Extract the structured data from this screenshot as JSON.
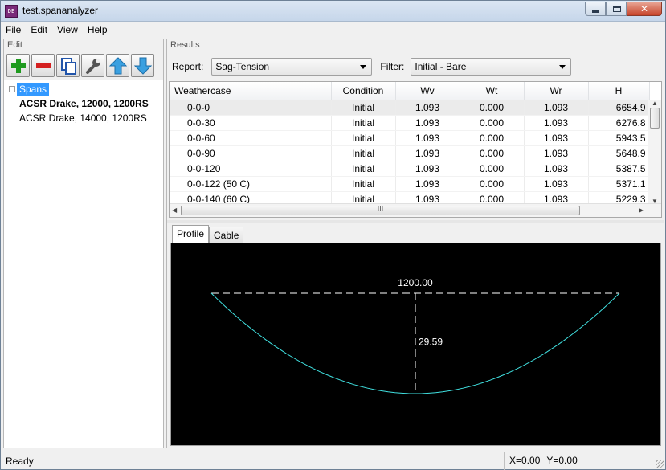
{
  "window": {
    "title": "test.spananalyzer",
    "icon": "app-icon",
    "icon_text": "DE"
  },
  "menu": [
    "File",
    "Edit",
    "View",
    "Help"
  ],
  "edit_pane": {
    "caption": "Edit",
    "toolbar": [
      {
        "name": "add-button",
        "icon": "plus-icon",
        "color": "#1f9a1f"
      },
      {
        "name": "delete-button",
        "icon": "minus-icon",
        "color": "#d42020"
      },
      {
        "name": "copy-button",
        "icon": "copy-icon",
        "color": "#2255aa"
      },
      {
        "name": "edit-button",
        "icon": "wrench-icon",
        "color": "#555555"
      },
      {
        "name": "move-up-button",
        "icon": "arrow-up-icon",
        "color": "#3aa0e0"
      },
      {
        "name": "move-down-button",
        "icon": "arrow-down-icon",
        "color": "#3aa0e0"
      }
    ],
    "tree": {
      "root": "Spans",
      "items": [
        {
          "label": "ACSR Drake, 12000, 1200RS",
          "bold": true
        },
        {
          "label": "ACSR Drake, 14000, 1200RS",
          "bold": false
        }
      ]
    }
  },
  "results_pane": {
    "caption": "Results",
    "report_label": "Report:",
    "report_value": "Sag-Tension",
    "filter_label": "Filter:",
    "filter_value": "Initial - Bare",
    "table": {
      "columns": [
        "Weathercase",
        "Condition",
        "Wv",
        "Wt",
        "Wr",
        "H"
      ],
      "rows": [
        [
          "0-0-0",
          "Initial",
          "1.093",
          "0.000",
          "1.093",
          "6654.9"
        ],
        [
          "0-0-30",
          "Initial",
          "1.093",
          "0.000",
          "1.093",
          "6276.8"
        ],
        [
          "0-0-60",
          "Initial",
          "1.093",
          "0.000",
          "1.093",
          "5943.5"
        ],
        [
          "0-0-90",
          "Initial",
          "1.093",
          "0.000",
          "1.093",
          "5648.9"
        ],
        [
          "0-0-120",
          "Initial",
          "1.093",
          "0.000",
          "1.093",
          "5387.5"
        ],
        [
          "0-0-122 (50 C)",
          "Initial",
          "1.093",
          "0.000",
          "1.093",
          "5371.1"
        ],
        [
          "0-0-140 (60 C)",
          "Initial",
          "1.093",
          "0.000",
          "1.093",
          "5229.3"
        ]
      ],
      "selected_row": 0,
      "hscroll_grip": "III"
    },
    "tabs": [
      {
        "label": "Profile",
        "active": true
      },
      {
        "label": "Cable",
        "active": false
      }
    ],
    "profile": {
      "span_label": "1200.00",
      "sag_label": "29.59",
      "curve_color": "#40e0e0",
      "line_color": "#ffffff"
    }
  },
  "statusbar": {
    "text": "Ready",
    "x": "X=0.00",
    "y": "Y=0.00"
  }
}
